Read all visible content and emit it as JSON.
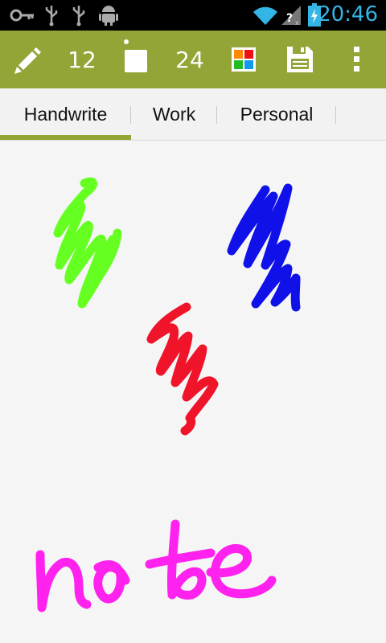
{
  "status_bar": {
    "time": "20:46",
    "icons": [
      "key-icon",
      "usb-icon",
      "usb-icon",
      "android-debug-icon",
      "wifi-icon",
      "no-sim-signal-icon",
      "battery-charging-icon"
    ],
    "accent_color": "#33b5e5"
  },
  "action_bar": {
    "background_color": "#93a536",
    "pen_size": "12",
    "eraser_size": "24",
    "icons": [
      "pencil-icon",
      "eraser-icon",
      "color-palette-icon",
      "save-icon",
      "overflow-menu-icon"
    ]
  },
  "tabs": {
    "items": [
      {
        "label": "Handwrite",
        "selected": true
      },
      {
        "label": "Work",
        "selected": false
      },
      {
        "label": "Personal",
        "selected": false
      }
    ],
    "indicator_color": "#93a536"
  },
  "canvas": {
    "strokes": [
      {
        "name": "green-scribble",
        "color": "#66ff22"
      },
      {
        "name": "blue-scribble",
        "color": "#1010e8"
      },
      {
        "name": "red-scribble",
        "color": "#f0142a"
      },
      {
        "name": "magenta-handwriting",
        "color": "#ff22ee"
      }
    ]
  }
}
